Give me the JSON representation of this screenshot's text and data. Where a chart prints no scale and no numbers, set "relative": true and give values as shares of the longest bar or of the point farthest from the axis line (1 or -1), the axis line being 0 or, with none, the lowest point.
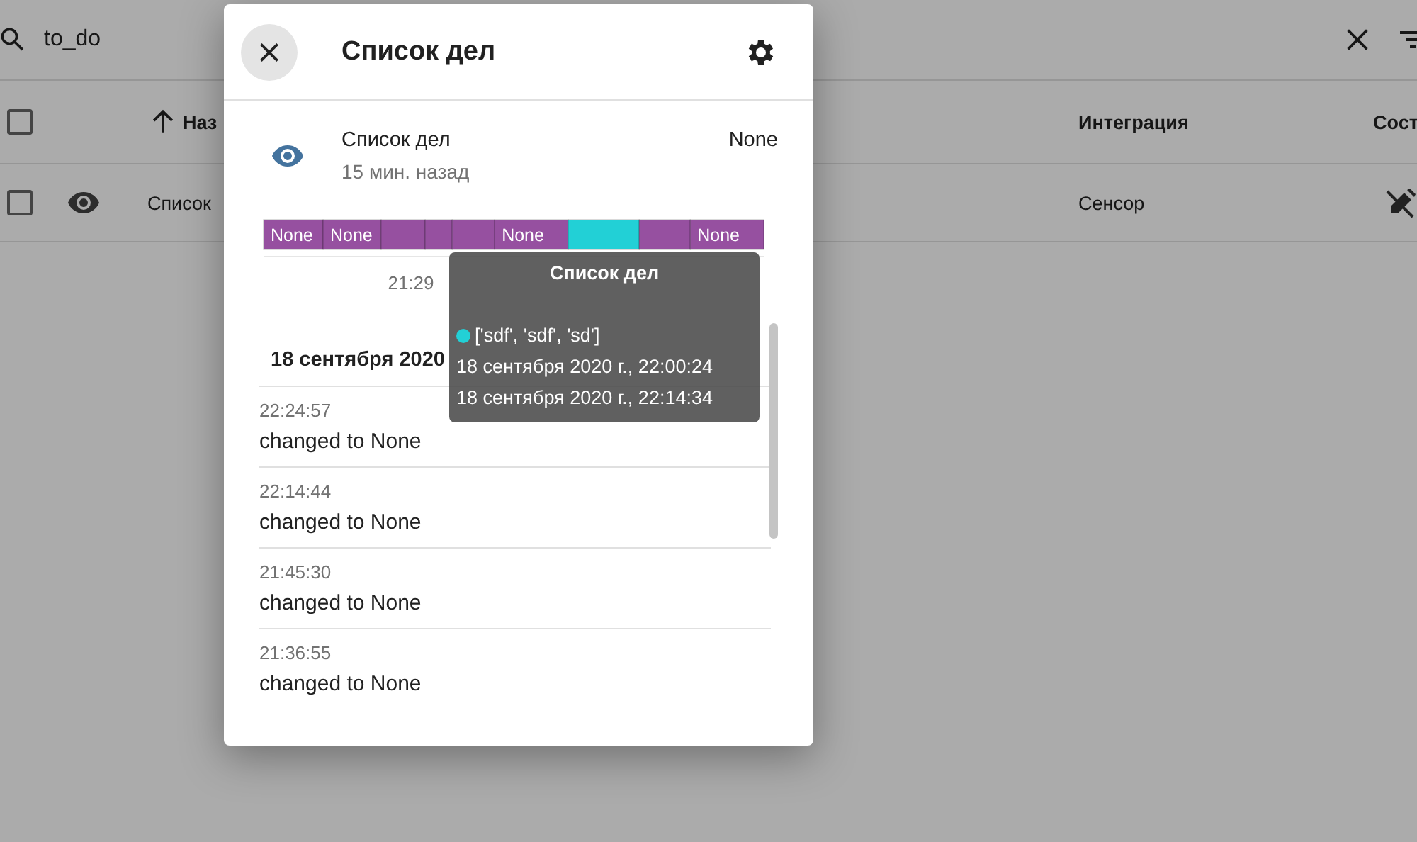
{
  "search": {
    "value": "to_do"
  },
  "table": {
    "header_checkbox": {
      "checked": false
    },
    "columns": [
      {
        "label": "Наз",
        "sorted": true
      },
      {
        "label": "Интеграция",
        "sorted": false
      },
      {
        "label": "Сост",
        "sorted": false
      }
    ],
    "rows": [
      {
        "checked": false,
        "name": "Список",
        "integration": "Сенсор"
      }
    ]
  },
  "dialog": {
    "title": "Список дел",
    "entity": {
      "name": "Список дел",
      "last_changed": "15 мин. назад",
      "state": "None"
    },
    "timeline": {
      "chart_data": {
        "type": "bar",
        "orientation": "horizontal",
        "stacked": true,
        "relative": true,
        "annotations": [
          "21:29"
        ],
        "series": [
          {
            "name": "None",
            "color": "#9650a0",
            "values": [
              0.119
            ]
          },
          {
            "name": "None",
            "color": "#9650a0",
            "values": [
              0.116
            ]
          },
          {
            "color": "#9650a0",
            "values": [
              0.088
            ]
          },
          {
            "color": "#9650a0",
            "values": [
              0.054
            ]
          },
          {
            "color": "#9650a0",
            "values": [
              0.085
            ]
          },
          {
            "name": "None",
            "color": "#9650a0",
            "values": [
              0.147
            ]
          },
          {
            "color": "#22d0d6",
            "values": [
              0.142
            ]
          },
          {
            "color": "#9650a0",
            "values": [
              0.102
            ]
          },
          {
            "name": "None",
            "color": "#9650a0",
            "values": [
              0.147
            ]
          }
        ]
      }
    },
    "tooltip": {
      "title": "Список дел",
      "color": "#22d0d6",
      "value": "['sdf', 'sdf', 'sd']",
      "start": "18 сентября 2020 г., 22:00:24",
      "end": "18 сентября 2020 г., 22:14:34"
    },
    "history": {
      "date": "18 сентября 2020",
      "entries": [
        {
          "time": "22:24:57",
          "message": "changed to None"
        },
        {
          "time": "22:14:44",
          "message": "changed to None"
        },
        {
          "time": "21:45:30",
          "message": "changed to None"
        },
        {
          "time": "21:36:55",
          "message": "changed to None"
        }
      ]
    }
  }
}
